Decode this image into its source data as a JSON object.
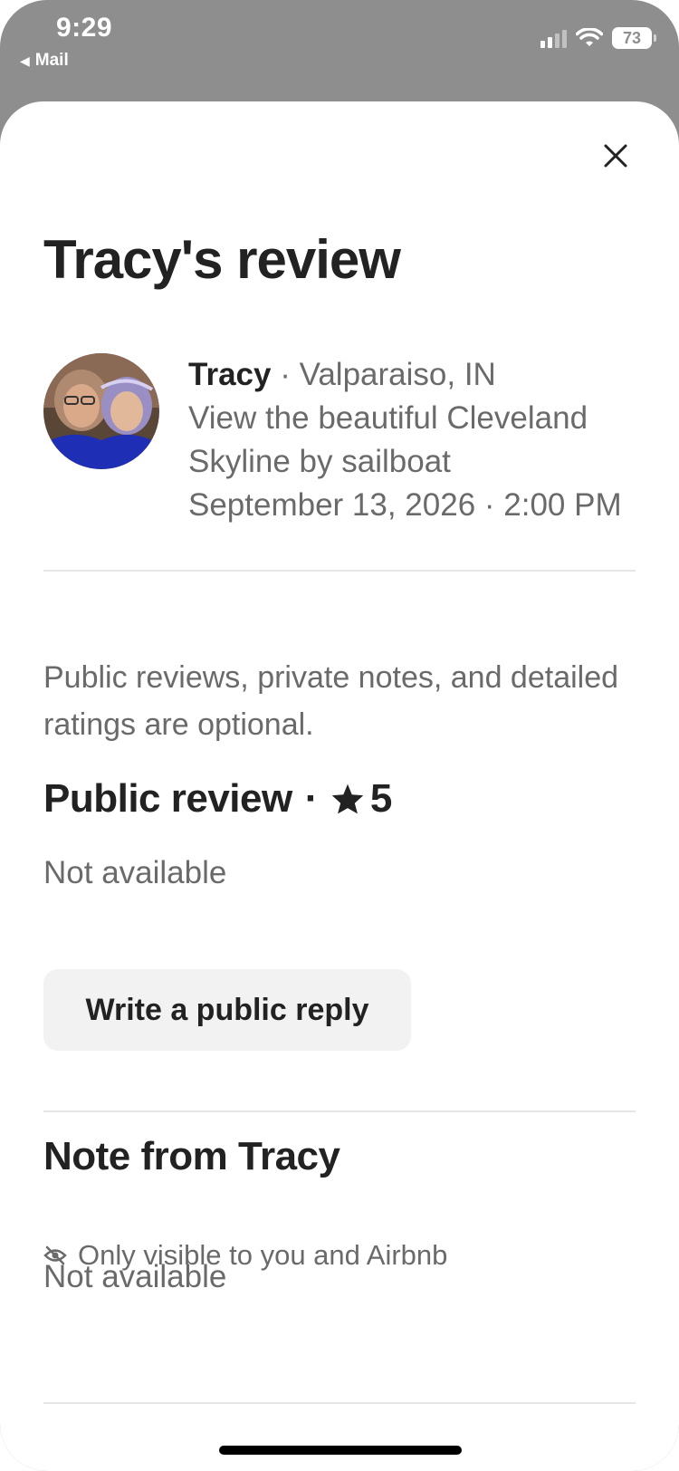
{
  "status_bar": {
    "time": "9:29",
    "back_app": "Mail",
    "battery": "73"
  },
  "sheet": {
    "title": "Tracy's review",
    "close_icon": "close-icon"
  },
  "reviewer": {
    "name": "Tracy",
    "location": "Valparaiso, IN",
    "experience": "View the beautiful Cleveland Skyline by sailboat",
    "date_time": "September 13, 2026 · 2:00 PM"
  },
  "intro_text": "Public reviews, private notes, and detailed ratings are optional.",
  "public_review": {
    "heading": "Public review",
    "rating": "5",
    "body": "Not available",
    "reply_button": "Write a public reply"
  },
  "private_note": {
    "heading": "Note from Tracy",
    "visibility": "Only visible to you and Airbnb",
    "body": "Not available"
  },
  "colors": {
    "text_primary": "#222222",
    "text_secondary": "#6a6a6a",
    "button_bg": "#f2f2f2"
  }
}
